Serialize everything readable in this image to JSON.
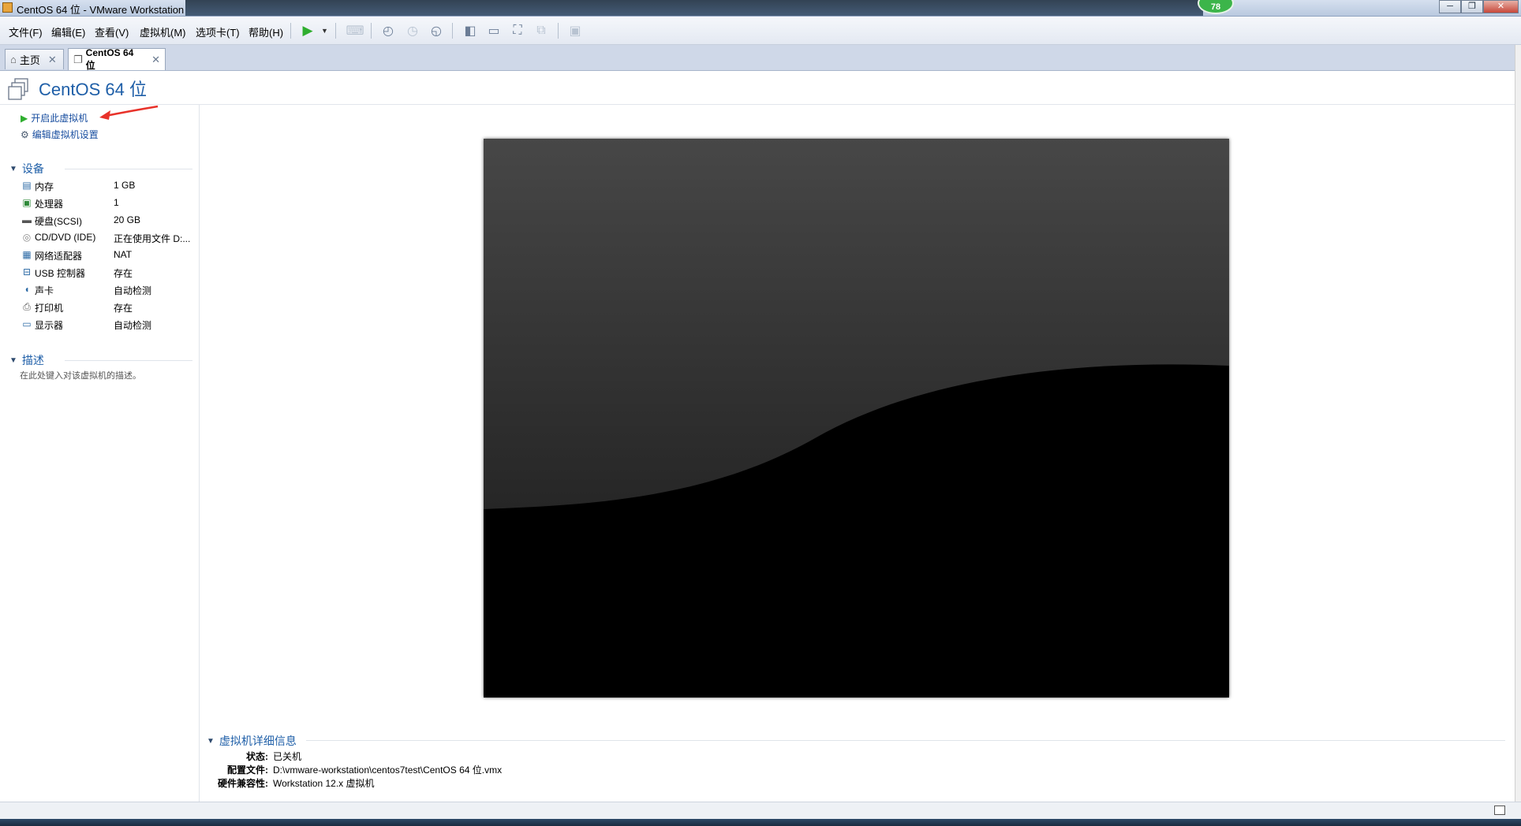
{
  "window": {
    "title": "CentOS 64 位 - VMware Workstation",
    "badge": "78",
    "controls": [
      "─",
      "❐",
      "✕"
    ]
  },
  "menu": {
    "file": "文件(F)",
    "edit": "编辑(E)",
    "view": "查看(V)",
    "vm": "虚拟机(M)",
    "tabs": "选项卡(T)",
    "help": "帮助(H)"
  },
  "toolbar": {
    "icons": [
      "play-icon",
      "dropdown-arrow-icon",
      "send-keys-icon",
      "snapshot-take-icon",
      "snapshot-revert-icon",
      "snapshot-manager-icon",
      "library-icon",
      "thumbnail-bar-icon",
      "fullscreen-icon",
      "unity-icon",
      "console-view-icon"
    ]
  },
  "tabs": [
    {
      "label": "主页",
      "icon": "home-icon",
      "close": "✕"
    },
    {
      "label": "CentOS 64 位",
      "icon": "vm-icon",
      "close": "✕",
      "active": true
    }
  ],
  "vm": {
    "title": "CentOS 64 位"
  },
  "actions": {
    "power_on": "开启此虚拟机",
    "edit_settings": "编辑虚拟机设置"
  },
  "devices": {
    "heading": "设备",
    "items": [
      {
        "name": "内存",
        "value": "1 GB",
        "icon": "memory-icon"
      },
      {
        "name": "处理器",
        "value": "1",
        "icon": "cpu-icon"
      },
      {
        "name": "硬盘(SCSI)",
        "value": "20 GB",
        "icon": "hard-disk-icon"
      },
      {
        "name": "CD/DVD (IDE)",
        "value": "正在使用文件 D:...",
        "icon": "cd-dvd-icon"
      },
      {
        "name": "网络适配器",
        "value": "NAT",
        "icon": "network-adapter-icon"
      },
      {
        "name": "USB 控制器",
        "value": "存在",
        "icon": "usb-icon"
      },
      {
        "name": "声卡",
        "value": "自动检测",
        "icon": "sound-card-icon"
      },
      {
        "name": "打印机",
        "value": "存在",
        "icon": "printer-icon"
      },
      {
        "name": "显示器",
        "value": "自动检测",
        "icon": "display-icon"
      }
    ]
  },
  "description": {
    "heading": "描述",
    "hint": "在此处键入对该虚拟机的描述。"
  },
  "details": {
    "heading": "虚拟机详细信息",
    "rows": [
      {
        "key": "状态:",
        "value": "已关机"
      },
      {
        "key": "配置文件:",
        "value": "D:\\vmware-workstation\\centos7test\\CentOS 64 位.vmx"
      },
      {
        "key": "硬件兼容性:",
        "value": "Workstation 12.x 虚拟机"
      }
    ]
  },
  "colors": {
    "accent": "#1f5fa8",
    "annotation": "#e8322a",
    "play": "#2fae2f"
  }
}
